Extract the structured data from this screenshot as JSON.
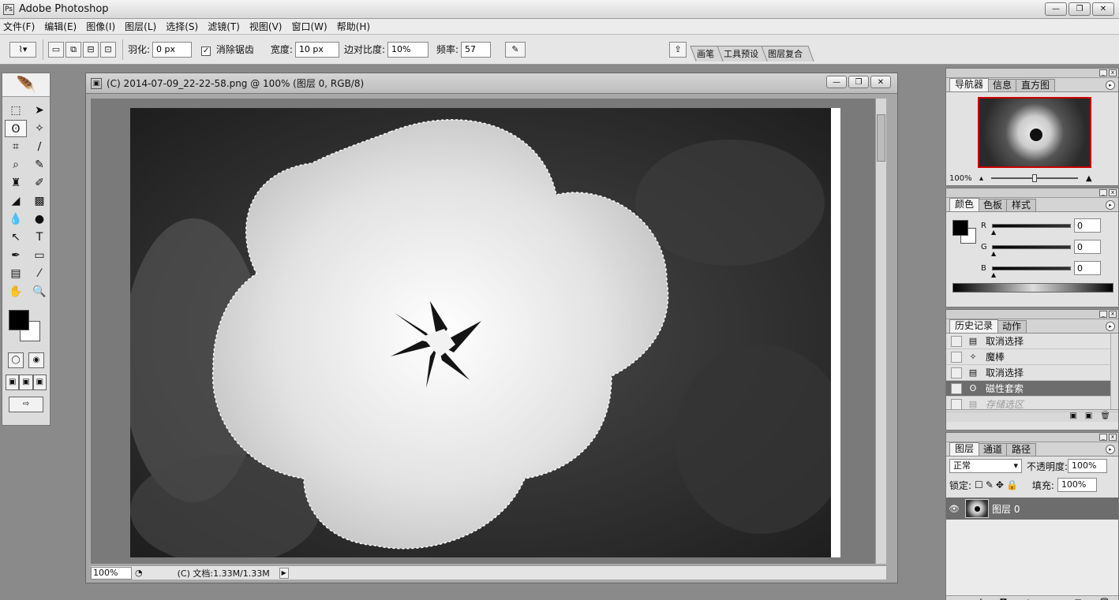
{
  "app": {
    "title": "Adobe Photoshop"
  },
  "window_controls": {
    "minimize": "—",
    "restore": "❐",
    "close": "✕"
  },
  "menu": [
    "文件(F)",
    "编辑(E)",
    "图像(I)",
    "图层(L)",
    "选择(S)",
    "滤镜(T)",
    "视图(V)",
    "窗口(W)",
    "帮助(H)"
  ],
  "options": {
    "feather_label": "羽化:",
    "feather_value": "0 px",
    "antialias_check": "✓",
    "antialias_label": "消除锯齿",
    "width_label": "宽度:",
    "width_value": "10 px",
    "contrast_label": "边对比度:",
    "contrast_value": "10%",
    "frequency_label": "频率:",
    "frequency_value": "57",
    "wells": [
      "画笔",
      "工具预设",
      "图层复合"
    ]
  },
  "document": {
    "title": "(C) 2014-07-09_22-22-58.png @ 100% (图层 0, RGB/8)",
    "zoom": "100%",
    "status": "(C) 文档:1.33M/1.33M"
  },
  "navigator": {
    "tabs": [
      "导航器",
      "信息",
      "直方图"
    ],
    "zoom": "100%"
  },
  "color": {
    "tabs": [
      "颜色",
      "色板",
      "样式"
    ],
    "r_label": "R",
    "r_value": "0",
    "g_label": "G",
    "g_value": "0",
    "b_label": "B",
    "b_value": "0"
  },
  "history": {
    "tabs": [
      "历史记录",
      "动作"
    ],
    "items": [
      "取消选择",
      "魔棒",
      "取消选择",
      "磁性套索",
      "存储选区"
    ]
  },
  "layers": {
    "tabs": [
      "图层",
      "通道",
      "路径"
    ],
    "blend_mode": "正常",
    "opacity_label": "不透明度:",
    "opacity_value": "100%",
    "lock_label": "锁定:",
    "fill_label": "填充:",
    "fill_value": "100%",
    "layer_name": "图层 0"
  },
  "colors": {
    "foreground": "#000000",
    "background": "#ffffff",
    "selection": "#6d6d6d"
  }
}
